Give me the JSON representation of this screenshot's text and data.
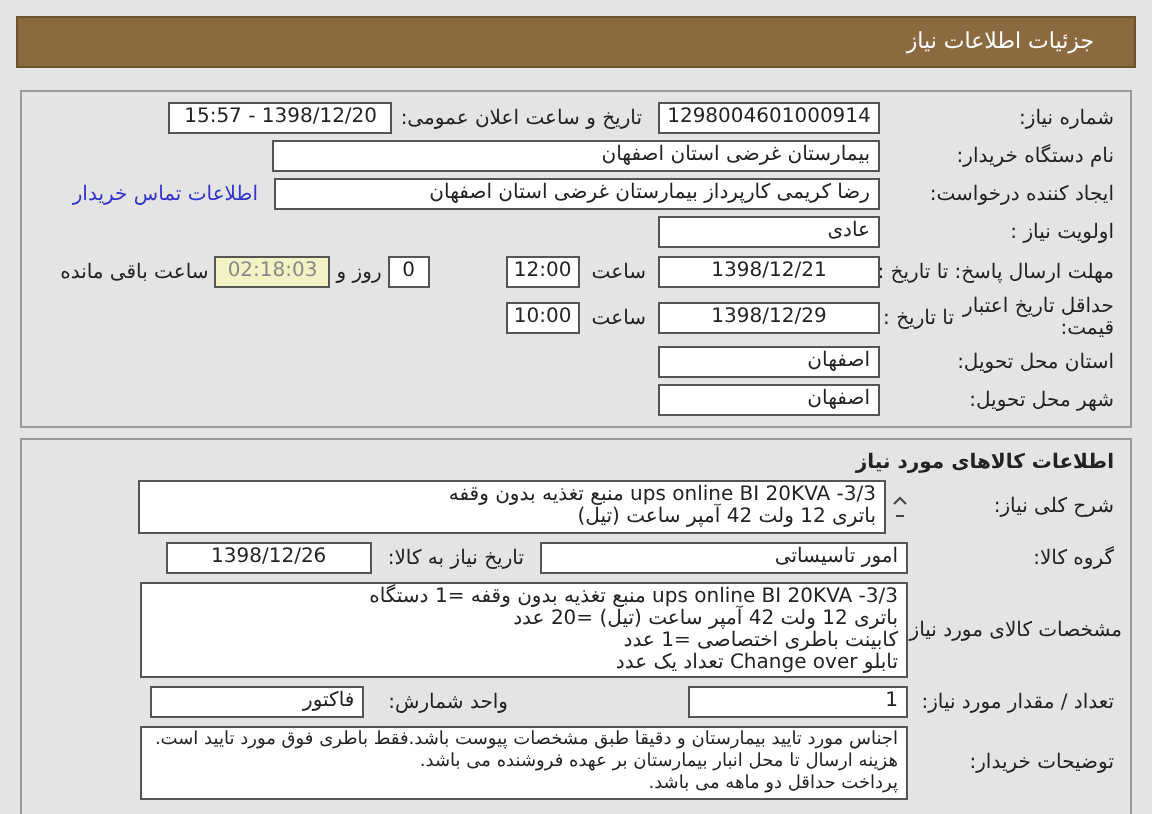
{
  "header": {
    "title": "جزئیات اطلاعات نیاز"
  },
  "details": {
    "need_number": {
      "label": "شماره نیاز:",
      "value": "1298004601000914"
    },
    "announce": {
      "label": "تاریخ و ساعت اعلان عمومی:",
      "value": "1398/12/20 - 15:57"
    },
    "buyer_org": {
      "label": "نام دستگاه خریدار:",
      "value": "بیمارستان غرضی استان اصفهان"
    },
    "creator": {
      "label": "ایجاد کننده درخواست:",
      "value": "رضا کریمی کارپرداز بیمارستان غرضی استان اصفهان",
      "link": "اطلاعات تماس خریدار"
    },
    "priority": {
      "label": "اولویت نیاز :",
      "value": "عادی"
    },
    "response_deadline": {
      "label": "مهلت ارسال پاسخ:",
      "to_label": "تا تاریخ :",
      "date": "1398/12/21",
      "time_label": "ساعت",
      "time": "12:00",
      "days": "0",
      "days_label": "روز و",
      "remaining": "02:18:03",
      "remaining_label": "ساعت باقی مانده"
    },
    "price_validity": {
      "label": "حداقل تاریخ اعتبار قیمت:",
      "to_label": "تا تاریخ :",
      "date": "1398/12/29",
      "time_label": "ساعت",
      "time": "10:00"
    },
    "province": {
      "label": "استان محل تحویل:",
      "value": "اصفهان"
    },
    "city": {
      "label": "شهر محل تحویل:",
      "value": "اصفهان"
    }
  },
  "goods": {
    "title": "اطلاعات کالاهای مورد نیاز",
    "general_description": {
      "label": "شرح کلی نیاز:",
      "lines": [
        "ups online BI 20KVA -3/3 منبع تغذیه بدون وقفه",
        "باتری 12 ولت 42 آمپر ساعت (تیل)"
      ]
    },
    "group": {
      "label": "گروه کالا:",
      "value": "امور تاسیساتی",
      "date_label": "تاریخ نیاز به کالا:",
      "date": "1398/12/26"
    },
    "specs": {
      "label": "مشخصات کالای مورد نیاز:",
      "lines": [
        "ups online BI 20KVA -3/3 منبع تغذیه بدون وقفه =1 دستگاه",
        "باتری 12 ولت 42 آمپر ساعت (تیل) =20 عدد",
        "کابینت باطری اختصاصی =1 عدد",
        "تابلو Change over تعداد یک عدد"
      ]
    },
    "quantity": {
      "label": "تعداد / مقدار مورد نیاز:",
      "value": "1",
      "unit_label": "واحد شمارش:",
      "unit": "فاکتور"
    },
    "buyer_notes": {
      "label": "توضیحات خریدار:",
      "lines": [
        "اجناس مورد تایید بیمارستان و دقیقا طبق مشخصات پیوست باشد.فقط باطری فوق مورد تایید است.",
        "هزینه ارسال تا محل انبار بیمارستان بر عهده فروشنده می باشد.",
        "پرداخت حداقل دو ماهه می باشد."
      ]
    }
  }
}
